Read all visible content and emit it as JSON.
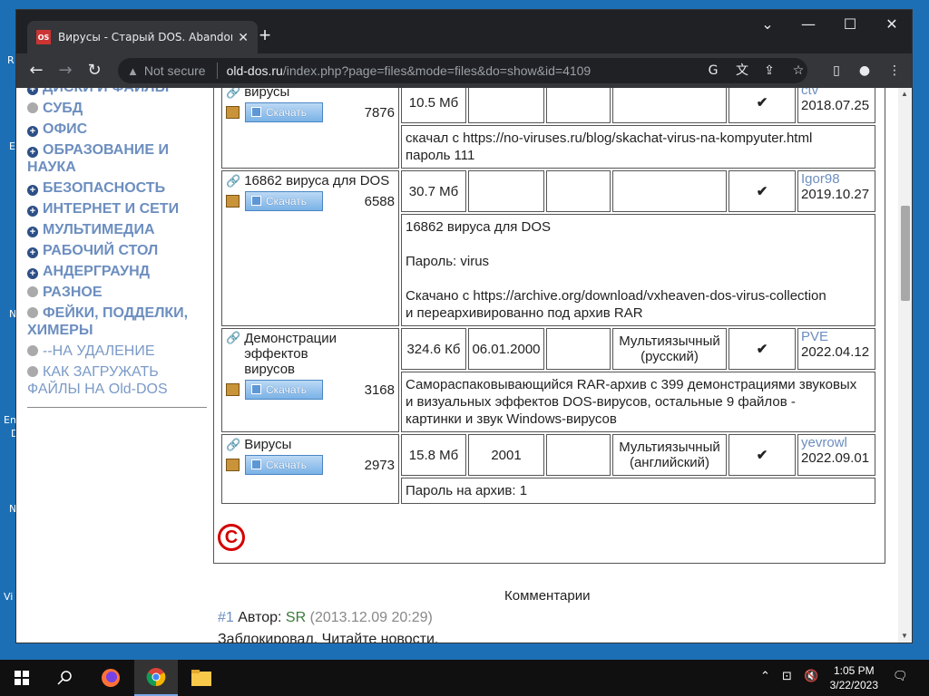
{
  "desktop": {
    "labels": [
      "R",
      "E",
      "N",
      "Vi",
      "En",
      "D",
      "N"
    ]
  },
  "browser": {
    "tab_title": "Вирусы - Старый DOS. Abandonware",
    "tab_favicon": "OS",
    "omnibox": {
      "security_label": "Not secure",
      "host": "old-dos.ru",
      "path": "/index.php?page=files&mode=files&do=show&id=4109"
    }
  },
  "sidebar": {
    "items": [
      {
        "label": "ДИСКИ И ФАЙЛЫ",
        "bullet": "plus"
      },
      {
        "label": "СУБД",
        "bullet": "dot"
      },
      {
        "label": "ОФИС",
        "bullet": "plus"
      },
      {
        "label": "ОБРАЗОВАНИЕ И НАУКА",
        "bullet": "plus"
      },
      {
        "label": "БЕЗОПАСНОСТЬ",
        "bullet": "plus"
      },
      {
        "label": "ИНТЕРНЕТ И СЕТИ",
        "bullet": "plus"
      },
      {
        "label": "МУЛЬТИМЕДИА",
        "bullet": "plus"
      },
      {
        "label": "РАБОЧИЙ СТОЛ",
        "bullet": "plus"
      },
      {
        "label": "АНДЕРГРАУНД",
        "bullet": "plus"
      },
      {
        "label": "РАЗНОЕ",
        "bullet": "dot"
      },
      {
        "label": "ФЕЙКИ, ПОДДЕЛКИ, ХИМЕРЫ",
        "bullet": "dot"
      },
      {
        "label": "--НА УДАЛЕНИЕ",
        "bullet": "dot",
        "plain": true
      },
      {
        "label": "КАК ЗАГРУЖАТЬ ФАЙЛЫ НА Old-DOS",
        "bullet": "dot",
        "plain": true
      }
    ]
  },
  "files": {
    "download_label": "Скачать",
    "rows": [
      {
        "name": "вирусы",
        "downloads": "7876",
        "size": "10.5 Мб",
        "date": "",
        "lang": "",
        "check": "✔",
        "user": "ctv",
        "added": "2018.07.25",
        "desc": [
          "скачал с https://no-viruses.ru/blog/skachat-virus-na-kompyuter.html",
          "пароль 111"
        ]
      },
      {
        "name": "16862 вируса для DOS",
        "downloads": "6588",
        "size": "30.7 Мб",
        "date": "",
        "lang": "",
        "check": "✔",
        "user": "Igor98",
        "added": "2019.10.27",
        "desc": [
          "16862 вируса для DOS",
          "",
          "Пароль: virus",
          "",
          "Скачано с https://archive.org/download/vxheaven-dos-virus-collection",
          "и переархивированно под архив RAR"
        ]
      },
      {
        "name": "Демонстрации эффектов вирусов",
        "downloads": "3168",
        "size": "324.6 Кб",
        "date": "06.01.2000",
        "lang": "Мультиязычный (русский)",
        "check": "✔",
        "user": "PVE",
        "added": "2022.04.12",
        "desc": [
          "Самораспаковывающийся RAR-архив с 399 демонстрациями звуковых",
          "и визуальных эффектов DOS-вирусов, остальные 9 файлов -",
          "картинки и звук Windows-вирусов"
        ]
      },
      {
        "name": "Вирусы",
        "downloads": "2973",
        "size": "15.8 Мб",
        "date": "2001",
        "lang": "Мультиязычный (английский)",
        "check": "✔",
        "user": "yevrowl",
        "added": "2022.09.01",
        "desc": [
          "Пароль на архив: 1"
        ]
      }
    ]
  },
  "comments": {
    "title": "Комментарии",
    "first": {
      "num": "#1",
      "author_label": "Автор:",
      "author": "SR",
      "date": "(2013.12.09 20:29)",
      "text": "Заблокировал. Читайте новости."
    }
  },
  "taskbar": {
    "time": "1:05 PM",
    "date": "3/22/2023"
  }
}
